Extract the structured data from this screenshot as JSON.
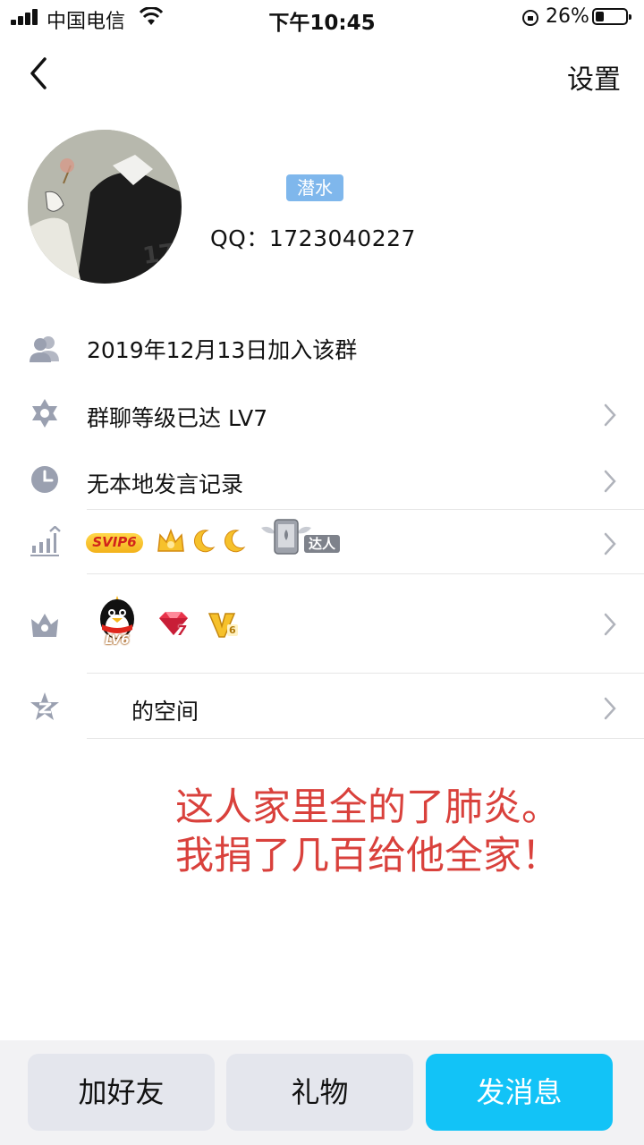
{
  "status_bar": {
    "carrier": "中国电信",
    "time": "下午10:45",
    "battery": "26%"
  },
  "nav": {
    "settings_label": "设置"
  },
  "profile": {
    "badge": "潜水",
    "qq": "QQ：1723040227"
  },
  "rows": {
    "joined": "2019年12月13日加入该群",
    "level": "群聊等级已达 LV7",
    "history": "无本地发言记录",
    "svip": "SVIP6",
    "daren": "达人",
    "qq_level": "LV6",
    "gem_level": "7",
    "v_level": "6",
    "space": "的空间"
  },
  "overlay_text": "这人家里全的了肺炎。\n我捐了几百给他全家！",
  "actions": {
    "add_friend": "加好友",
    "gift": "礼物",
    "message": "发消息"
  },
  "colors": {
    "accent": "#12c3f7",
    "badge": "#7fb7ec",
    "overlay": "#d9413c",
    "icon": "#9aa0b0"
  }
}
